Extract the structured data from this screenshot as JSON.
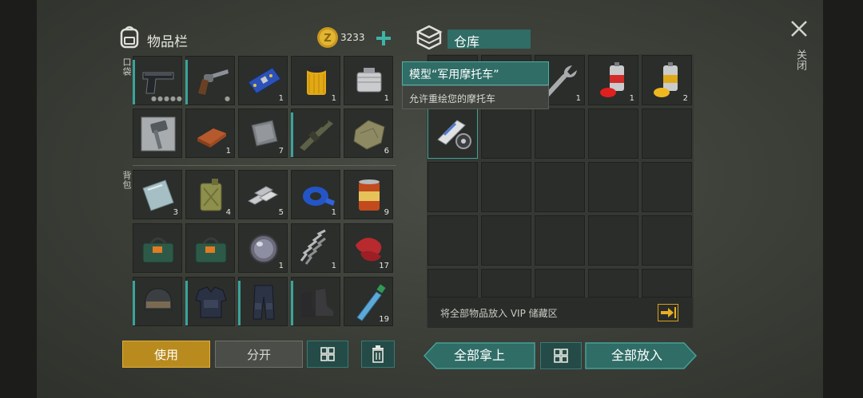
{
  "inventory": {
    "title": "物品栏",
    "coins": "3233",
    "pocket_label": "口袋",
    "backpack_label": "背包",
    "pocket_slots": [
      {
        "icon": "pistol-icon",
        "count": ""
      },
      {
        "icon": "revolver-icon",
        "count": ""
      },
      {
        "icon": "circuit-board-icon",
        "count": "1"
      },
      {
        "icon": "oil-filter-icon",
        "count": "1"
      },
      {
        "icon": "engine-block-icon",
        "count": "1"
      },
      {
        "icon": "sledgehammer-icon",
        "count": ""
      },
      {
        "icon": "copper-ingot-icon",
        "count": "1"
      },
      {
        "icon": "metal-plate-icon",
        "count": "7"
      },
      {
        "icon": "assault-rifle-icon",
        "count": ""
      },
      {
        "icon": "cloth-rag-icon",
        "count": "6"
      }
    ],
    "backpack_slots": [
      {
        "icon": "glass-sheet-icon",
        "count": "3"
      },
      {
        "icon": "jerrycan-icon",
        "count": "4"
      },
      {
        "icon": "metal-bars-icon",
        "count": "5"
      },
      {
        "icon": "duct-tape-icon",
        "count": "1"
      },
      {
        "icon": "food-can-icon",
        "count": "9"
      },
      {
        "icon": "explosive-box-icon",
        "count": ""
      },
      {
        "icon": "explosive-box-icon",
        "count": ""
      },
      {
        "icon": "lens-icon",
        "count": "1"
      },
      {
        "icon": "spring-icon",
        "count": "1"
      },
      {
        "icon": "raw-meat-icon",
        "count": "17"
      },
      {
        "icon": "helmet-icon",
        "count": ""
      },
      {
        "icon": "armor-vest-icon",
        "count": ""
      },
      {
        "icon": "armored-pants-icon",
        "count": ""
      },
      {
        "icon": "boots-icon",
        "count": ""
      },
      {
        "icon": "water-bottle-icon",
        "count": "19"
      }
    ],
    "use_button": "使用",
    "split_button": "分开"
  },
  "storage": {
    "title": "仓库",
    "slots_row1": [
      {
        "icon": "",
        "count": ""
      },
      {
        "icon": "",
        "count": ""
      },
      {
        "icon": "wrench-icon",
        "count": "1"
      },
      {
        "icon": "red-spray-paint-icon",
        "count": "1"
      },
      {
        "icon": "yellow-spray-paint-icon",
        "count": "2"
      }
    ],
    "vip_text": "将全部物品放入 VIP 储藏区",
    "take_all_button": "全部拿上",
    "put_all_button": "全部放入"
  },
  "tooltip": {
    "title": "模型“军用摩托车”",
    "description": "允许重绘您的摩托车"
  },
  "close_label": "关闭",
  "colors": {
    "accent_teal": "#2f6d66",
    "gold_button": "#b98b1e",
    "count_text": "#e6e6e0"
  }
}
